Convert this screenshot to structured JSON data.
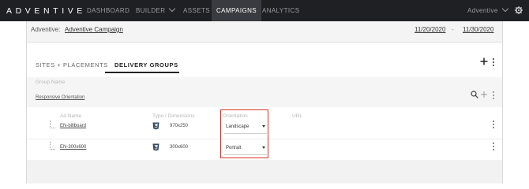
{
  "nav": {
    "logo": "ADVENTIVE",
    "items": [
      "DASHBOARD",
      "BUILDER",
      "ASSETS",
      "CAMPAIGNS",
      "ANALYTICS"
    ],
    "active": "CAMPAIGNS",
    "account": "Adventive"
  },
  "info": {
    "label": "Adventive:",
    "campaign": "Adventive Campaign",
    "start_date": "11/20/2020",
    "separator": "-",
    "end_date": "11/30/2020"
  },
  "tabs": [
    "SITES + PLACEMENTS",
    "DELIVERY GROUPS"
  ],
  "active_tab": "DELIVERY GROUPS",
  "group": {
    "label": "Group Name",
    "name": "Responsive Orientation"
  },
  "columns": [
    "Ad Name",
    "Type / Dimensions",
    "Orientation",
    "URL"
  ],
  "rows": [
    {
      "name": "EN-billboard",
      "type_icon": "html5-icon",
      "dims": "970x250",
      "orientation": "Landscape",
      "url": ""
    },
    {
      "name": "EN-300x600",
      "type_icon": "html5-icon",
      "dims": "300x600",
      "orientation": "Portrait",
      "url": ""
    }
  ],
  "colors": {
    "topbar": "#1f2024",
    "highlight": "#d9342b",
    "html5": "#34495e"
  }
}
